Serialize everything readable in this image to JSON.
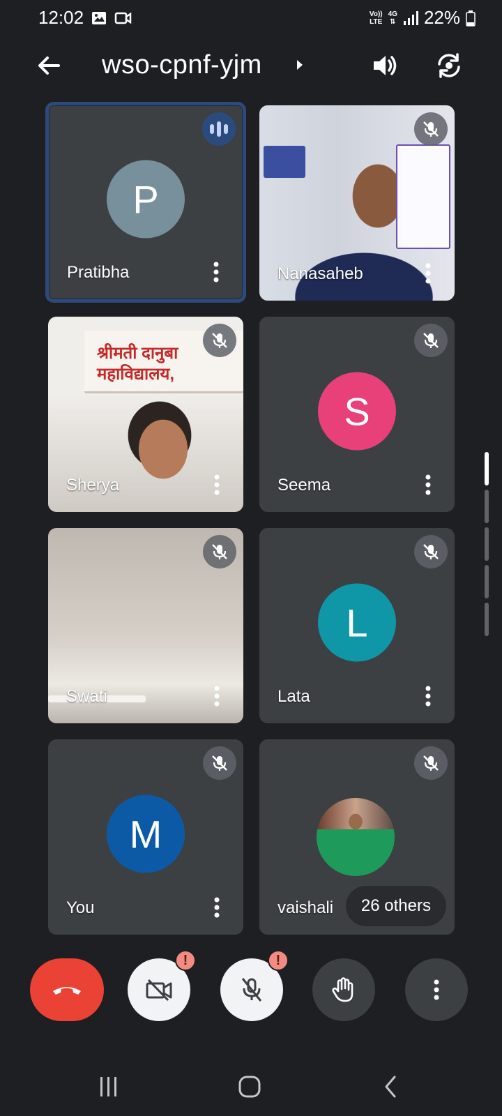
{
  "status_bar": {
    "time": "12:02",
    "network_top": "Vo))",
    "network_bottom": "LTE",
    "gen_top": "4G",
    "gen_bottom": "⇅",
    "battery": "22%"
  },
  "top_bar": {
    "meeting_code": "wso-cpnf-yjm"
  },
  "participants": [
    {
      "name": "Pratibha",
      "initial": "P",
      "avatar_color": "#78909c",
      "speaking": true
    },
    {
      "name": "Nanasaheb",
      "muted": true,
      "video": true
    },
    {
      "name": "Sherya",
      "muted": true,
      "video": true,
      "poster_line1": "श्रीमती दानुबा",
      "poster_line2": "महाविद्यालय,"
    },
    {
      "name": "Seema",
      "initial": "S",
      "avatar_color": "#e8417a",
      "muted": true
    },
    {
      "name": "Swati",
      "muted": true,
      "video": true
    },
    {
      "name": "Lata",
      "initial": "L",
      "avatar_color": "#0f97a7",
      "muted": true
    },
    {
      "name": "You",
      "initial": "M",
      "avatar_color": "#0c5aa6",
      "muted": true
    },
    {
      "name": "vaishali",
      "muted": true,
      "others_label": "26 others"
    }
  ],
  "controls": {
    "warning_mark": "!"
  },
  "colors": {
    "background": "#1e1f22",
    "tile": "#3c4043",
    "end_call": "#ea4335",
    "active_border": "#2f4a7a"
  }
}
